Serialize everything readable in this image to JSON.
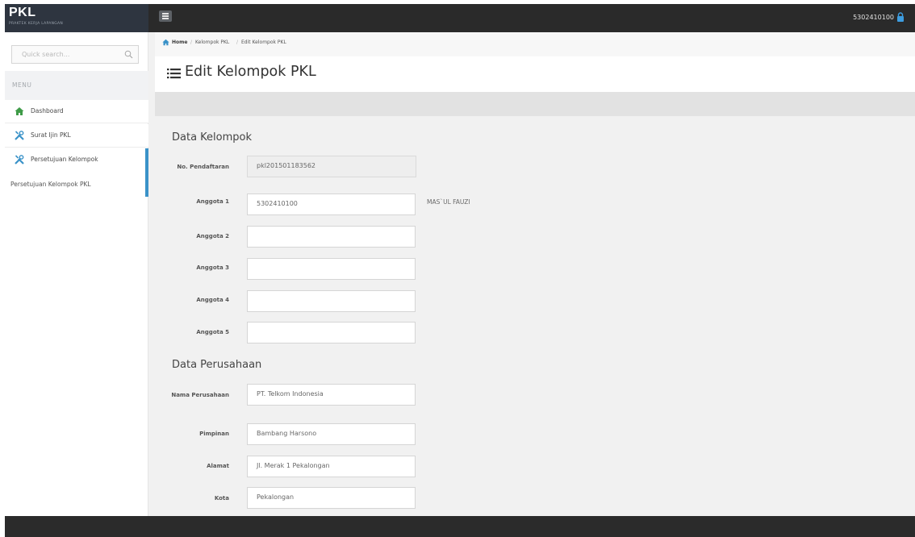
{
  "header": {
    "brand_title": "PKL",
    "brand_subtitle": "PRAKTEK KERJA LAPANGAN",
    "user_id": "53024101​00"
  },
  "sidebar": {
    "search_placeholder": "Quick search...",
    "menu_header": "MENU",
    "items": [
      {
        "label": "Dashboard",
        "icon": "home-icon"
      },
      {
        "label": "Surat Ijin PKL",
        "icon": "tools-icon"
      },
      {
        "label": "Persetujuan Kelompok",
        "icon": "tools-icon"
      }
    ],
    "sub_item": "Persetujuan Kelompok PKL"
  },
  "breadcrumb": {
    "items": [
      "Home",
      "Kelompok PKL",
      "Edit Kelompok PKL"
    ]
  },
  "page": {
    "title": "Edit Kelompok PKL"
  },
  "data_kelompok": {
    "title": "Data Kelompok",
    "no_pendaftaran_label": "No. Pendaftaran",
    "no_pendaftaran_value": "pkl201501183562",
    "members": [
      {
        "label": "Anggota 1",
        "value": "5302410100",
        "name": "MAS`UL FAUZI"
      },
      {
        "label": "Anggota 2",
        "value": ""
      },
      {
        "label": "Anggota 3",
        "value": ""
      },
      {
        "label": "Anggota 4",
        "value": ""
      },
      {
        "label": "Anggota 5",
        "value": ""
      }
    ]
  },
  "data_perusahaan": {
    "title": "Data Perusahaan",
    "fields": [
      {
        "label": "Nama Perusahaan",
        "value": "PT. Telkom Indonesia"
      },
      {
        "label": "Pimpinan",
        "value": "Bambang Harsono"
      },
      {
        "label": "Alamat",
        "value": "Jl. Merak 1 Pekalongan"
      },
      {
        "label": "Kota",
        "value": "Pekalongan"
      }
    ]
  },
  "colors": {
    "topbar": "#2a2a2a",
    "accent": "#3a92c8",
    "home_icon": "#3f9b48",
    "tools_icon": "#3a92c8",
    "lock_icon": "#3d9de0"
  }
}
